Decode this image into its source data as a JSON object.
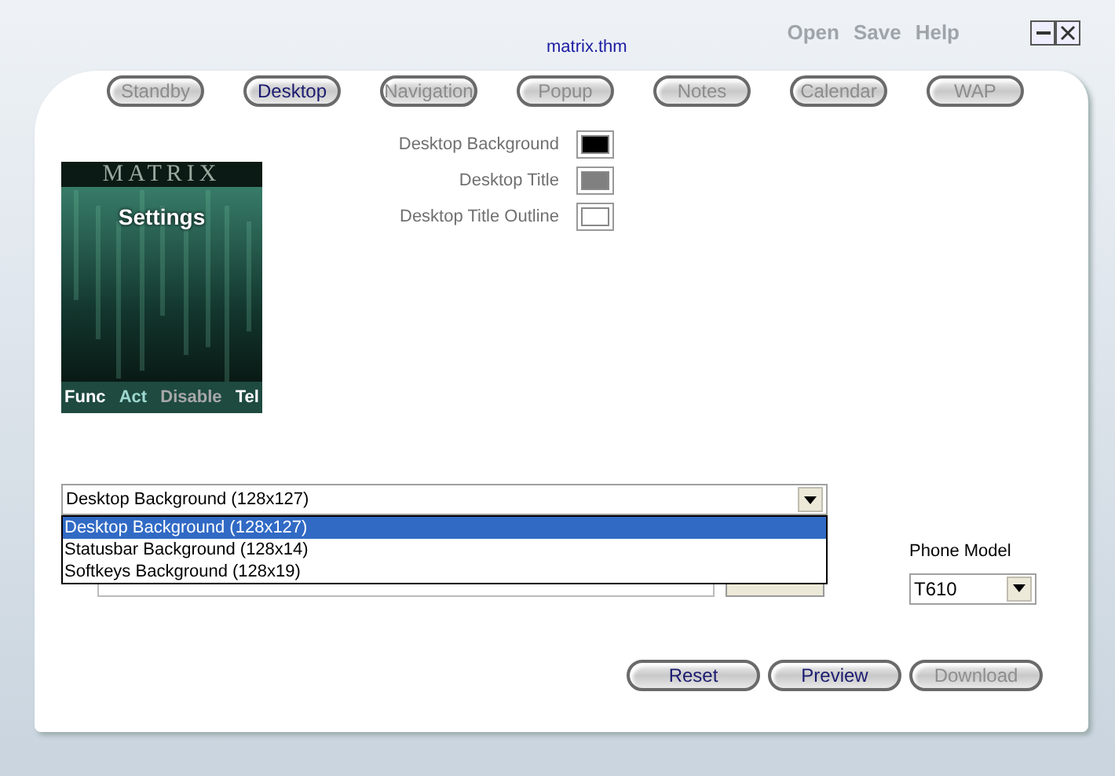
{
  "window": {
    "title": "matrix.thm"
  },
  "menu": [
    {
      "label": "Open"
    },
    {
      "label": "Save"
    },
    {
      "label": "Help"
    }
  ],
  "tabs": [
    {
      "label": "Standby",
      "selected": false
    },
    {
      "label": "Desktop",
      "selected": true
    },
    {
      "label": "Navigation",
      "selected": false
    },
    {
      "label": "Popup",
      "selected": false
    },
    {
      "label": "Notes",
      "selected": false
    },
    {
      "label": "Calendar",
      "selected": false
    },
    {
      "label": "WAP",
      "selected": false
    }
  ],
  "preview": {
    "banner": "MATRIX",
    "screen_title": "Settings",
    "softkeys": [
      {
        "label": "Func",
        "color": "#ffffff"
      },
      {
        "label": "Act",
        "color": "#9fd8d0"
      },
      {
        "label": "Disable",
        "color": "#a8a8a8"
      },
      {
        "label": "Tel",
        "color": "#ffffff"
      }
    ]
  },
  "swatches": [
    {
      "label": "Desktop Background",
      "color": "#000000"
    },
    {
      "label": "Desktop Title",
      "color": "#808080"
    },
    {
      "label": "Desktop Title Outline",
      "color": "#ffffff"
    }
  ],
  "image_select": {
    "value": "Desktop Background (128x127)",
    "expanded": true,
    "options": [
      {
        "label": "Desktop Background (128x127)",
        "selected": true
      },
      {
        "label": "Statusbar Background (128x14)",
        "selected": false
      },
      {
        "label": "Softkeys Background (128x19)",
        "selected": false
      }
    ]
  },
  "phone_model": {
    "label": "Phone Model",
    "value": "T610"
  },
  "buttons": [
    {
      "label": "Reset",
      "disabled": false
    },
    {
      "label": "Preview",
      "disabled": false
    },
    {
      "label": "Download",
      "disabled": true
    }
  ]
}
